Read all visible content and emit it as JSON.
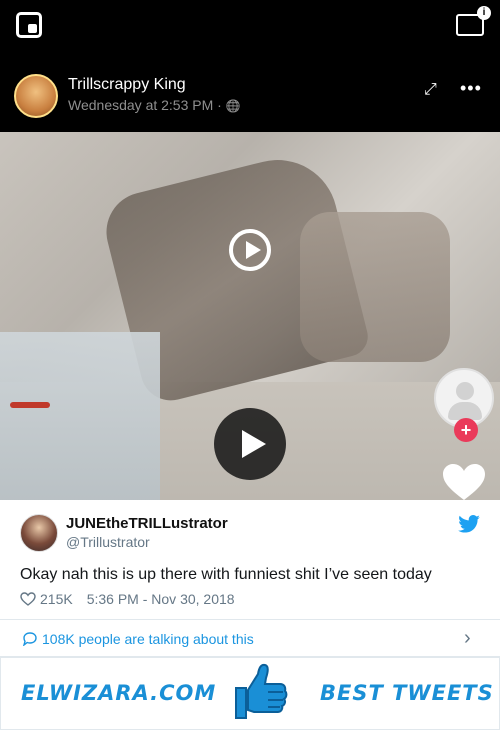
{
  "video": {
    "author_name": "Trillscrappy King",
    "post_time": "Wednesday at 2:53 PM · ",
    "globe_glyph": "🌐",
    "expand_glyph": "⤢",
    "more_glyph": "•••",
    "tv_badge": "i",
    "plus_glyph": "+",
    "icons": [
      "picture-in-picture-icon",
      "tv-icon",
      "expand-icon",
      "more-icon",
      "play-icon",
      "heart-icon"
    ]
  },
  "tweet": {
    "name": "JUNEtheTRILLustrator",
    "handle": "@Trillustrator",
    "text": "Okay nah this is up there with funniest shit I’ve seen today",
    "likes": "215K",
    "timestamp": "5:36 PM - Nov 30, 2018",
    "talking": "108K people are talking about this",
    "chevron": "›",
    "colors": {
      "link": "#1b95e0",
      "muted": "#657786",
      "heart_red": "#ea3a5a"
    }
  },
  "banner": {
    "left_text": "ELWIZARA.COM",
    "right_text": "BEST TWEETS",
    "accent": "#1a8fd6"
  }
}
